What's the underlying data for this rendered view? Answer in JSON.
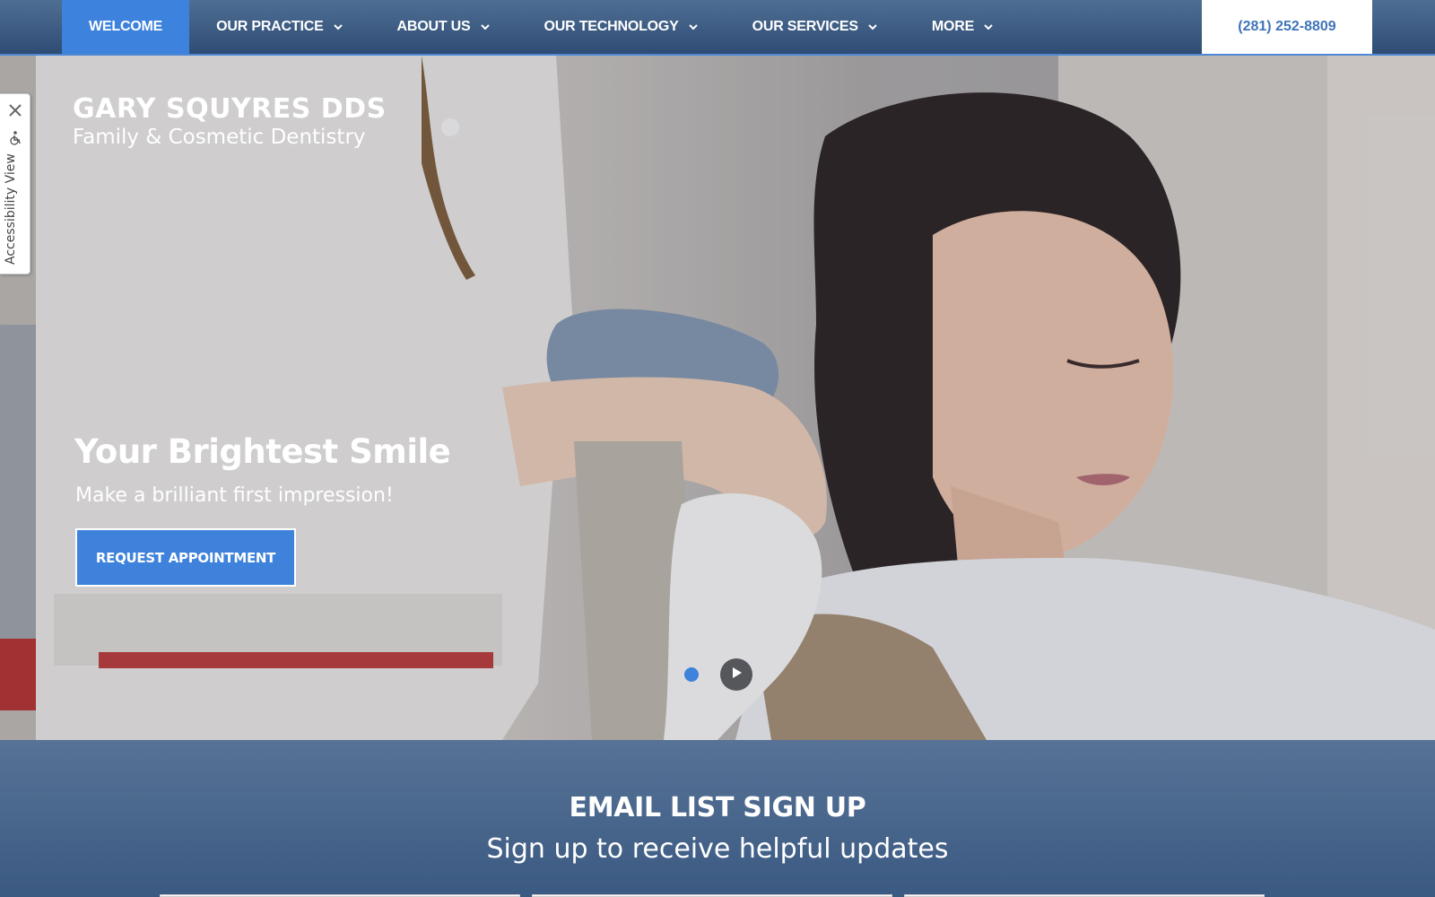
{
  "nav": {
    "items": [
      {
        "label": "WELCOME",
        "active": true,
        "dropdown": false
      },
      {
        "label": "OUR PRACTICE",
        "active": false,
        "dropdown": true
      },
      {
        "label": "ABOUT US",
        "active": false,
        "dropdown": true
      },
      {
        "label": "OUR TECHNOLOGY",
        "active": false,
        "dropdown": true
      },
      {
        "label": "OUR SERVICES",
        "active": false,
        "dropdown": true
      },
      {
        "label": "MORE",
        "active": false,
        "dropdown": true
      }
    ],
    "phone": "(281) 252-8809"
  },
  "brand": {
    "title": "GARY SQUYRES DDS",
    "subtitle": "Family & Cosmetic Dentistry"
  },
  "hero": {
    "headline": "Your Brightest Smile",
    "tagline": "Make a brilliant first impression!",
    "cta_label": "REQUEST APPOINTMENT"
  },
  "accessibility": {
    "label": "Accessibility View"
  },
  "signup": {
    "title": "EMAIL LIST SIGN UP",
    "subtitle": "Sign up to receive helpful updates"
  },
  "colors": {
    "accent": "#3e82dc",
    "nav_dark": "#2f4d74",
    "phone_text": "#3e74b8"
  }
}
